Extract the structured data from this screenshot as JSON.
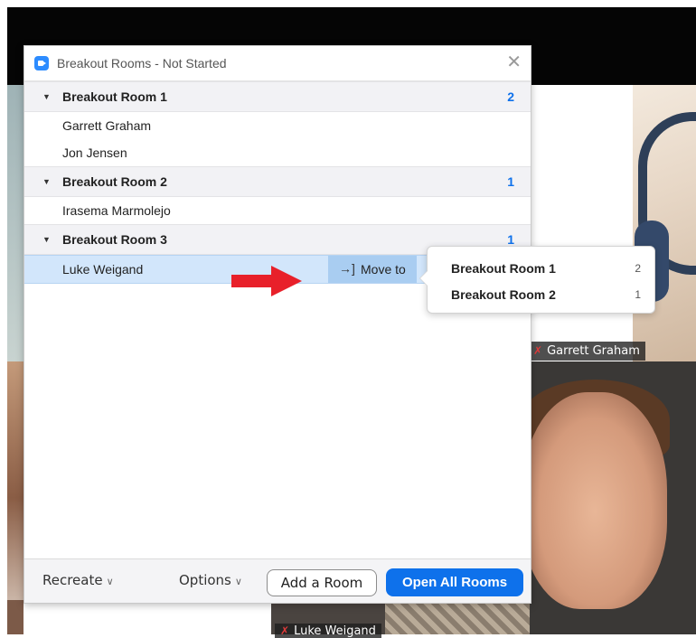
{
  "dialog": {
    "title": "Breakout Rooms - Not Started",
    "close_glyph": "✕"
  },
  "rooms": [
    {
      "name": "Breakout Room 1",
      "count": "2",
      "participants": [
        "Garrett Graham",
        "Jon Jensen"
      ]
    },
    {
      "name": "Breakout Room 2",
      "count": "1",
      "participants": [
        "Irasema Marmolejo"
      ]
    },
    {
      "name": "Breakout Room 3",
      "count": "1",
      "participants": [
        "Luke Weigand"
      ]
    }
  ],
  "move_to": {
    "label": "Move to",
    "icon": "→]"
  },
  "move_menu": [
    {
      "name": "Breakout Room 1",
      "count": "2"
    },
    {
      "name": "Breakout Room 2",
      "count": "1"
    }
  ],
  "footer": {
    "recreate": "Recreate",
    "options": "Options",
    "add_room": "Add a Room",
    "open_all": "Open All Rooms"
  },
  "video_tags": {
    "garrett": "Garrett Graham",
    "luke": "Luke Weigand"
  },
  "colors": {
    "accent": "#0e71eb",
    "selected_row": "#d2e6fb",
    "arrow": "#e8202a"
  }
}
